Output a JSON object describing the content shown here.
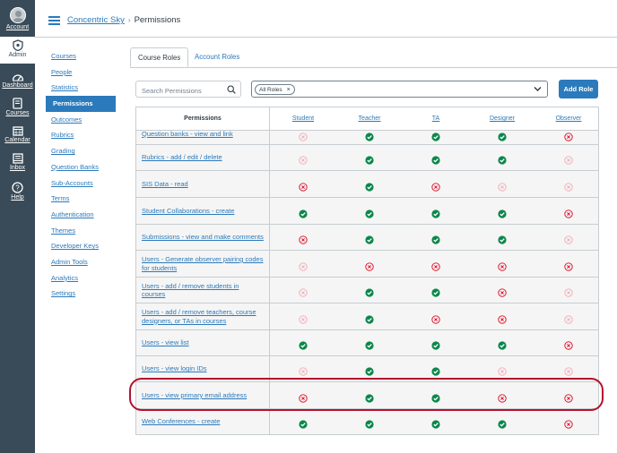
{
  "global_nav": [
    {
      "id": "account",
      "label": "Account",
      "icon": "user-avatar-icon"
    },
    {
      "id": "admin",
      "label": "Admin",
      "icon": "shield-icon"
    },
    {
      "id": "dashboard",
      "label": "Dashboard",
      "icon": "dashboard-icon"
    },
    {
      "id": "courses",
      "label": "Courses",
      "icon": "book-icon"
    },
    {
      "id": "calendar",
      "label": "Calendar",
      "icon": "calendar-icon"
    },
    {
      "id": "inbox",
      "label": "Inbox",
      "icon": "inbox-icon"
    },
    {
      "id": "help",
      "label": "Help",
      "icon": "help-icon"
    }
  ],
  "breadcrumb": {
    "account": "Concentric Sky",
    "separator": "›",
    "current": "Permissions"
  },
  "course_nav": [
    "Courses",
    "People",
    "Statistics",
    "Permissions",
    "Outcomes",
    "Rubrics",
    "Grading",
    "Question Banks",
    "Sub-Accounts",
    "Terms",
    "Authentication",
    "Themes",
    "Developer Keys",
    "Admin Tools",
    "Analytics",
    "Settings"
  ],
  "course_nav_active": "Permissions",
  "tabs": [
    {
      "label": "Course Roles",
      "active": true
    },
    {
      "label": "Account Roles",
      "active": false
    }
  ],
  "search": {
    "placeholder": "Search Permissions",
    "value": ""
  },
  "roles_filter": {
    "selected": "All Roles",
    "remove": "×"
  },
  "add_role_label": "Add Role",
  "table": {
    "header": "Permissions",
    "roles": [
      "Student",
      "Teacher",
      "TA",
      "Designer",
      "Observer"
    ],
    "legend": {
      "enabled": "#0b874b",
      "disabled": "#e0061f",
      "disabled_default": "#f2aab4"
    },
    "rows": [
      {
        "name": "Question banks - view and link",
        "values": [
          "x_light",
          "check",
          "check",
          "check",
          "x"
        ]
      },
      {
        "name": "Rubrics - add / edit / delete",
        "values": [
          "x_light",
          "check",
          "check",
          "check",
          "x_light"
        ]
      },
      {
        "name": "SIS Data - read",
        "values": [
          "x",
          "check",
          "x",
          "x_light",
          "x_light"
        ]
      },
      {
        "name": "Student Collaborations - create",
        "values": [
          "check",
          "check",
          "check",
          "check",
          "x"
        ]
      },
      {
        "name": "Submissions - view and make comments",
        "values": [
          "x",
          "check",
          "check",
          "check",
          "x_light"
        ]
      },
      {
        "name": "Users - Generate observer pairing codes for students",
        "values": [
          "x_light",
          "x",
          "x",
          "x",
          "x"
        ]
      },
      {
        "name": "Users - add / remove students in courses",
        "values": [
          "x_light",
          "check",
          "check",
          "x",
          "x_light"
        ]
      },
      {
        "name": "Users - add / remove teachers, course designers, or TAs in courses",
        "values": [
          "x_light",
          "check",
          "x",
          "x",
          "x_light"
        ]
      },
      {
        "name": "Users - view list",
        "values": [
          "check",
          "check",
          "check",
          "check",
          "x"
        ]
      },
      {
        "name": "Users - view login IDs",
        "values": [
          "x_light",
          "check",
          "check",
          "x_light",
          "x_light"
        ]
      },
      {
        "name": "Users - view primary email address",
        "values": [
          "x",
          "check",
          "check",
          "x",
          "x"
        ]
      },
      {
        "name": "Web Conferences - create",
        "values": [
          "check",
          "check",
          "check",
          "check",
          "x"
        ]
      }
    ]
  }
}
